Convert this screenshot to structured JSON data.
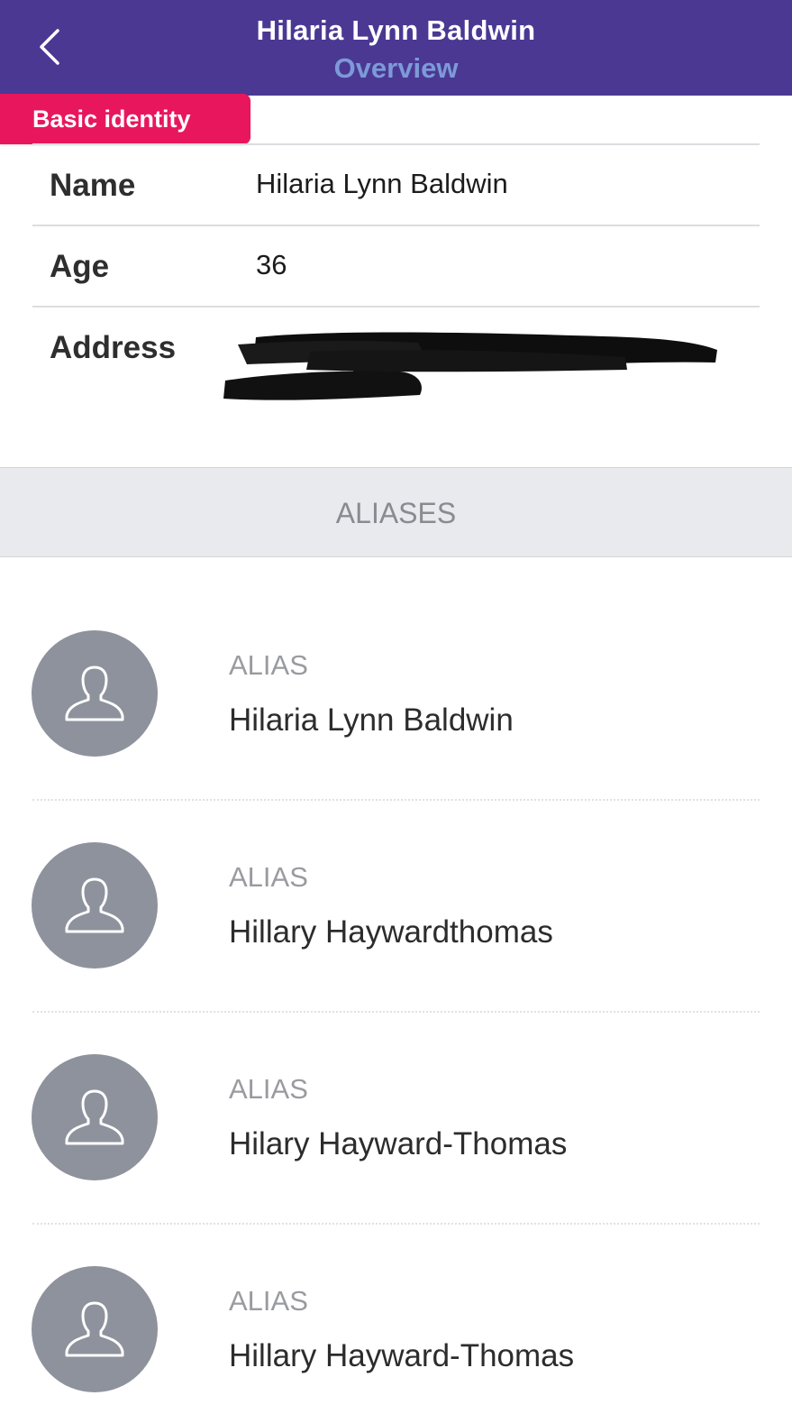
{
  "header": {
    "title": "Hilaria Lynn Baldwin",
    "subtitle": "Overview",
    "back_icon": "chevron-left-icon"
  },
  "section_tag": "Basic identity",
  "info": {
    "name_label": "Name",
    "name_value": "Hilaria Lynn Baldwin",
    "age_label": "Age",
    "age_value": "36",
    "address_label": "Address",
    "address_value_line1": "",
    "address_value_line2": ""
  },
  "aliases_header": "ALIASES",
  "aliases": [
    {
      "caption": "ALIAS",
      "name": "Hilaria Lynn Baldwin"
    },
    {
      "caption": "ALIAS",
      "name": "Hillary Haywardthomas"
    },
    {
      "caption": "ALIAS",
      "name": "Hilary Hayward-Thomas"
    },
    {
      "caption": "ALIAS",
      "name": "Hillary Hayward-Thomas"
    }
  ],
  "colors": {
    "header_bg": "#4b3893",
    "subtitle": "#7d9ad8",
    "tag_bg": "#e8175d",
    "avatar_bg": "#8e929c"
  }
}
